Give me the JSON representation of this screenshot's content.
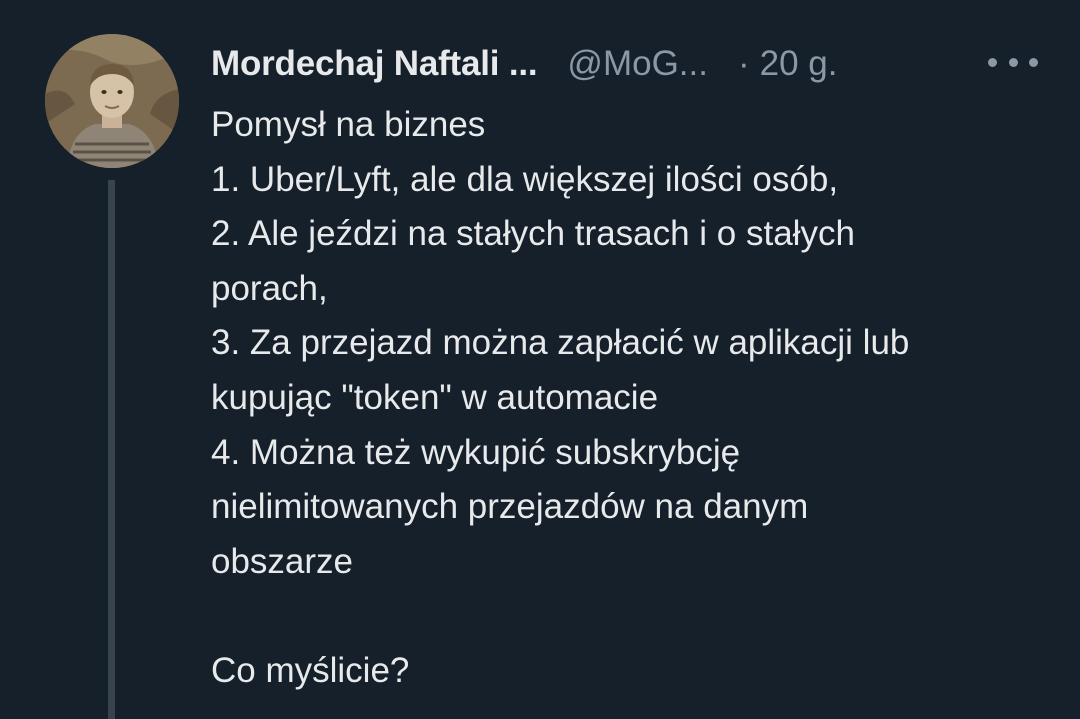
{
  "tweet": {
    "author": {
      "display_name": "Mordechaj Naftali ...",
      "handle": "@MoG...",
      "avatar_icon": "avatar-photo"
    },
    "separator": "·",
    "timestamp": "20 g.",
    "more_icon": "more-horizontal-icon",
    "lines": [
      "Pomysł na biznes",
      "1. Uber/Lyft, ale dla większej ilości osób,",
      "2. Ale jeździ na stałych trasach i o stałych",
      "porach,",
      "3. Za przejazd można zapłacić w aplikacji lub",
      "kupując \"token\" w automacie",
      "4. Można też wykupić subskrybcję",
      "nielimitowanych przejazdów na danym",
      "obszarze",
      "",
      "Co myślicie?"
    ]
  },
  "colors": {
    "background": "#15202b",
    "primary_text": "#e7e9ea",
    "secondary_text": "#8b98a5",
    "thread_line": "#38444d"
  }
}
